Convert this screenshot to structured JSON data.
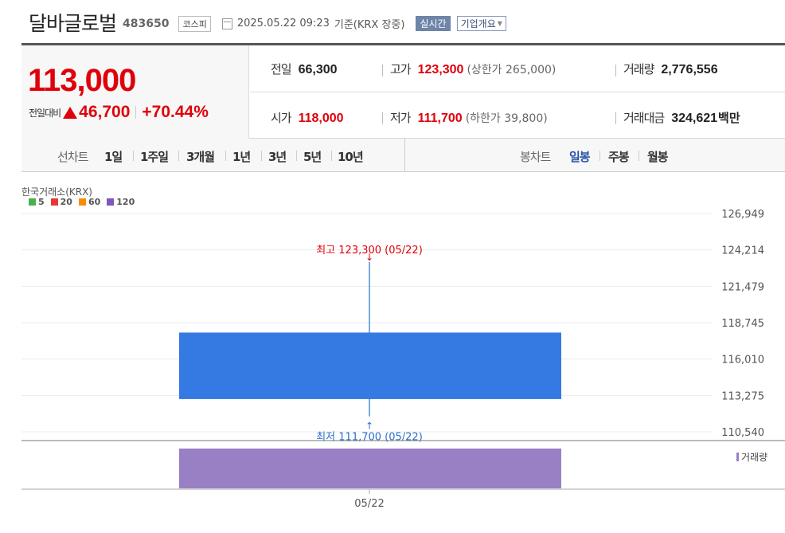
{
  "header": {
    "stock_name": "달바글로벌",
    "stock_code": "483650",
    "market": "코스피",
    "datetime": "2025.05.22 09:23",
    "basis": "기준(KRX 장중)",
    "realtime_label": "실시간",
    "company_button": "기업개요",
    "icons": {
      "date": "document-icon",
      "dropdown": "chevron-down-icon"
    }
  },
  "summary": {
    "current_price": "113,000",
    "change_label": "전일대비",
    "change_value": "46,700",
    "change_rate": "+70.44%",
    "prev_close_label": "전일",
    "prev_close": "66,300",
    "high_label": "고가",
    "high": "123,300",
    "upper_limit": "(상한가 265,000)",
    "volume_label": "거래량",
    "volume": "2,776,556",
    "open_label": "시가",
    "open": "118,000",
    "low_label": "저가",
    "low": "111,700",
    "lower_limit": "(하한가 39,800)",
    "value_label": "거래대금",
    "value": "324,621",
    "value_unit": "백만",
    "colors": {
      "up": "#e0000b"
    }
  },
  "periods": {
    "line_label": "선차트",
    "line_items": [
      "1일",
      "1주일",
      "3개월",
      "1년",
      "3년",
      "5년",
      "10년"
    ],
    "candle_label": "봉차트",
    "candle_items": [
      "일봉",
      "주봉",
      "월봉"
    ],
    "active": "일봉"
  },
  "chart_data": {
    "type": "candlestick",
    "source_label": "한국거래소(KRX)",
    "legend": [
      {
        "name": "5",
        "color": "#4caf50"
      },
      {
        "name": "20",
        "color": "#e53935"
      },
      {
        "name": "60",
        "color": "#fb8c00"
      },
      {
        "name": "120",
        "color": "#7e57c2"
      }
    ],
    "candles": [
      {
        "date": "05/22",
        "open": 118000,
        "high": 123300,
        "low": 111700,
        "close": 113000,
        "volume": 2776556
      }
    ],
    "y_ticks": [
      "126,949",
      "124,214",
      "121,479",
      "118,745",
      "116,010",
      "113,275",
      "110,540"
    ],
    "ylim": [
      110540,
      126949
    ],
    "x_ticks": [
      "05/22"
    ],
    "high_annotation": "최고 123,300 (05/22)",
    "low_annotation": "최저 111,700 (05/22)",
    "volume_legend": "거래량",
    "colors": {
      "candle": "#3579e3",
      "wick": "#4a90d9",
      "volume": "#9980c4",
      "high_text": "#e0000b",
      "low_text": "#2a6fc9"
    }
  }
}
